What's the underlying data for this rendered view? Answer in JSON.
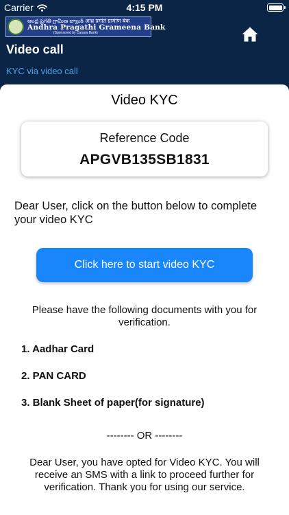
{
  "status_bar": {
    "carrier": "Carrier",
    "time": "4:15 PM",
    "wifi_icon": "wifi-icon",
    "battery_icon": "battery-icon",
    "battery_level": 1.0
  },
  "header": {
    "logo": {
      "native_text": "ఆంధ్ర ప్రగతి గ్రామీణ బ్యాంక్ आंध्र प्रगति ग्रामीण बैंक",
      "name": "Andhra Pragathi Grameena Bank",
      "sponsor": "(Sponsored by Canara Bank)"
    },
    "home_icon": "home-icon",
    "title": "Video call",
    "subtitle": "KYC via video call"
  },
  "content": {
    "title": "Video KYC",
    "reference": {
      "label": "Reference Code",
      "code": "APGVB135SB1831"
    },
    "intro": "Dear User, click on the button below to complete your video KYC",
    "start_button_label": "Click here to start video KYC",
    "documents_note": "Please have the following documents with you for verification.",
    "documents": [
      "1. Aadhar Card",
      "2. PAN CARD",
      "3. Blank Sheet of paper(for signature)"
    ],
    "or_divider": "-------- OR --------",
    "footer_note": "Dear User, you have opted for Video KYC. You will receive an SMS with a link to proceed further for verification. Thank you for using our service."
  },
  "colors": {
    "header_background": "#0b2546",
    "accent_button": "#1a86fb",
    "subtitle": "#4fa3ea"
  }
}
